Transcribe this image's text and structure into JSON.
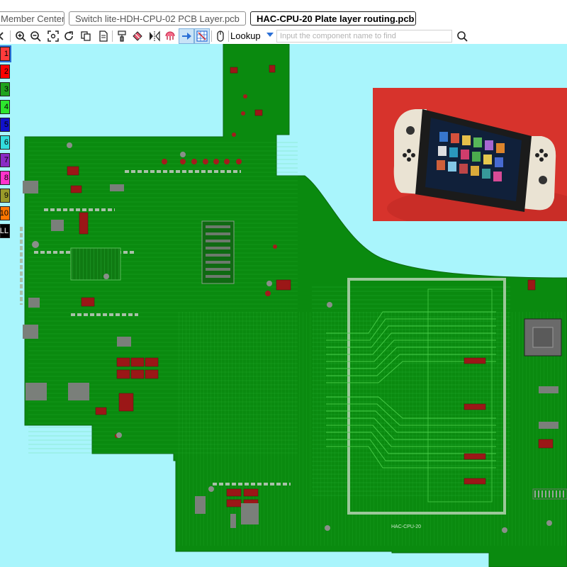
{
  "tabs": [
    {
      "label": "Member Center",
      "active": false
    },
    {
      "label": "Switch lite-HDH-CPU-02 PCB Layer.pcb",
      "active": false
    },
    {
      "label": "HAC-CPU-20 Plate layer routing.pcb",
      "active": true
    }
  ],
  "toolbar": {
    "icons": [
      "zoom-in-icon",
      "zoom-out-icon",
      "fit-view-icon",
      "rotate-icon",
      "copy-icon",
      "paint-brush-icon",
      "eraser-icon",
      "mirror-icon",
      "probe-icon",
      "layer-arrow-icon",
      "grid-select-icon",
      "mouse-icon"
    ],
    "lookup_label": "Lookup",
    "search_placeholder": "Input the component name to find"
  },
  "layers": [
    {
      "label": "1",
      "color": "#ff3b3b"
    },
    {
      "label": "2",
      "color": "#ff0000"
    },
    {
      "label": "3",
      "color": "#1fa31f"
    },
    {
      "label": "4",
      "color": "#2ee62e"
    },
    {
      "label": "5",
      "color": "#1111cc"
    },
    {
      "label": "6",
      "color": "#33dddd"
    },
    {
      "label": "7",
      "color": "#8a2bc4"
    },
    {
      "label": "8",
      "color": "#ff33cc"
    },
    {
      "label": "9",
      "color": "#9a9a2a"
    },
    {
      "label": "10",
      "color": "#ff7700"
    },
    {
      "label": "ALL",
      "color": "#000000"
    }
  ],
  "board": {
    "silkscreen": "HAC-CPU-20",
    "board_color": "#0a8a0f",
    "background_color": "#a9f5fc"
  }
}
